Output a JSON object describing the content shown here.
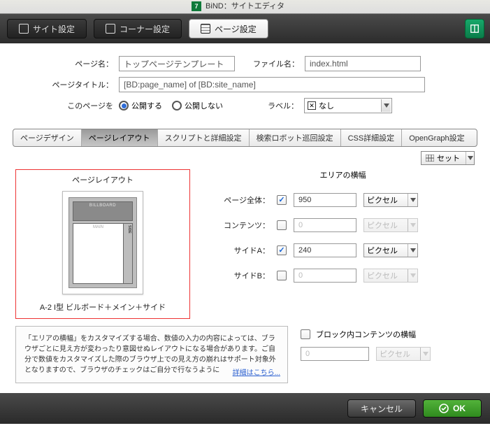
{
  "window": {
    "title": "BiND：サイトエディタ",
    "app_icon_text": "7"
  },
  "main_tabs": {
    "site": "サイト設定",
    "corner": "コーナー設定",
    "page": "ページ設定"
  },
  "form": {
    "page_name_label": "ページ名：",
    "page_name_value": "トップページテンプレート",
    "file_name_label": "ファイル名：",
    "file_name_value": "index.html",
    "page_title_label": "ページタイトル：",
    "page_title_value": "[BD:page_name] of [BD:site_name]",
    "publish_label": "このページを",
    "publish_public": "公開する",
    "publish_private": "公開しない",
    "label_label": "ラベル：",
    "label_value": "なし"
  },
  "sub_tabs": {
    "design": "ページデザイン",
    "layout": "ページレイアウト",
    "script": "スクリプトと詳細設定",
    "robot": "検索ロボット巡回設定",
    "css": "CSS詳細設定",
    "og": "OpenGraph設定"
  },
  "set_button": "セット",
  "layout": {
    "heading": "ページレイアウト",
    "thumb_billboard": "BILLBOARD",
    "thumb_main": "MAIN",
    "thumb_side": "SIDE",
    "caption": "A-2 I型 ビルボード＋メイン＋サイド"
  },
  "widths": {
    "heading": "エリアの横幅",
    "page_label": "ページ全体：",
    "page_value": "950",
    "page_unit": "ピクセル",
    "contents_label": "コンテンツ：",
    "contents_value": "0",
    "contents_unit": "ピクセル",
    "sideA_label": "サイドA：",
    "sideA_value": "240",
    "sideA_unit": "ピクセル",
    "sideB_label": "サイドB：",
    "sideB_value": "0",
    "sideB_unit": "ピクセル"
  },
  "note": {
    "text": "「エリアの横幅」をカスタマイズする場合、数値の入力の内容によっては、ブラウザごとに見え方が変わったり意図せぬレイアウトになる場合があります。ご自分で数値をカスタマイズした際のブラウザ上での見え方の崩れはサポート対象外となりますので、ブラウザのチェックはご自分で行なうように",
    "link": "詳細はこちら..."
  },
  "block_width": {
    "label": "ブロック内コンテンツの横幅",
    "value": "0",
    "unit": "ピクセル"
  },
  "footer": {
    "cancel": "キャンセル",
    "ok": "OK"
  }
}
